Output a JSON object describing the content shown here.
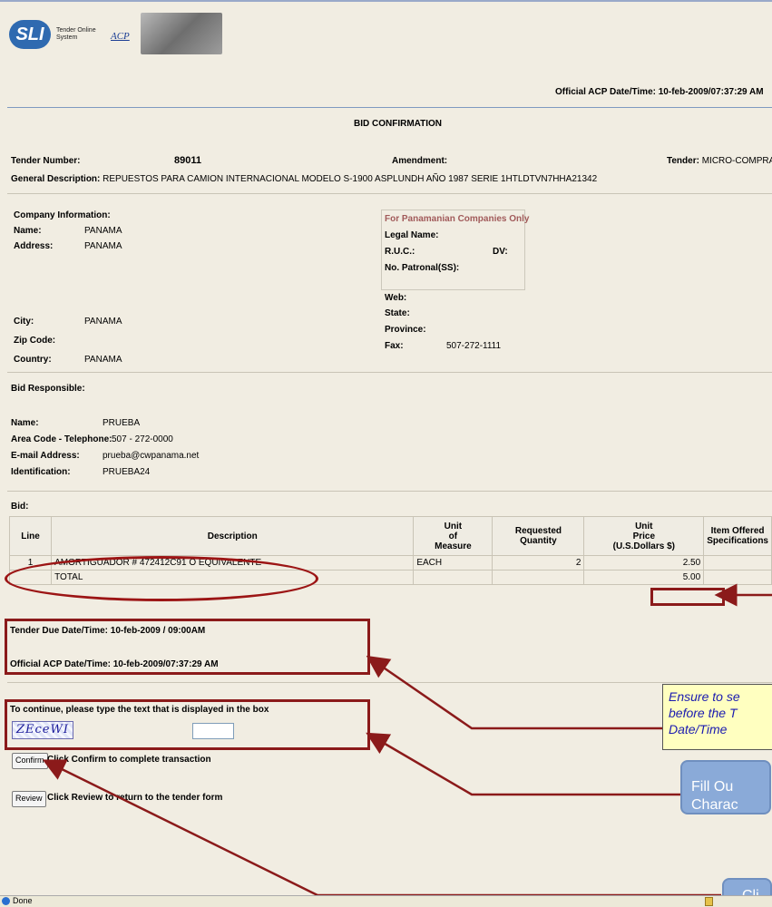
{
  "header": {
    "logo_text": "SLI",
    "logo_subtitle_1": "Tender Online",
    "logo_subtitle_2": "System",
    "acp_logo": "ACP",
    "official_datetime": "Official ACP Date/Time: 10-feb-2009/07:37:29 AM"
  },
  "title": "BID CONFIRMATION",
  "tender": {
    "number_label": "Tender Number:",
    "number": "89011",
    "amendment_label": "Amendment:",
    "tender_label": "Tender:",
    "tender_value": "MICRO-COMPRA",
    "description_label": "General Description:",
    "description": "REPUESTOS PARA CAMION INTERNACIONAL MODELO S-1900 ASPLUNDH AÑO 1987 SERIE 1HTLDTVN7HHA21342"
  },
  "company": {
    "section_label": "Company Information:",
    "name_label": "Name:",
    "name": "PANAMA",
    "address_label": "Address:",
    "address": "PANAMA",
    "city_label": "City:",
    "city": "PANAMA",
    "zip_label": "Zip Code:",
    "country_label": "Country:",
    "country": "PANAMA",
    "panama_only": "For Panamanian Companies Only",
    "legal_name_label": "Legal Name:",
    "ruc_label": "R.U.C.:",
    "dv_label": "DV:",
    "patronal_label": "No. Patronal(SS):",
    "web_label": "Web:",
    "state_label": "State:",
    "province_label": "Province:",
    "fax_label": "Fax:",
    "fax": "507-272-1111"
  },
  "responsible": {
    "section_label": "Bid Responsible:",
    "name_label": "Name:",
    "name": "PRUEBA",
    "phone_label": "Area Code - Telephone:",
    "phone": "507 - 272-0000",
    "email_label": "E-mail Address:",
    "email": "prueba@cwpanama.net",
    "id_label": "Identification:",
    "id": "PRUEBA24"
  },
  "bid": {
    "section_label": "Bid:",
    "columns": [
      "Line",
      "Description",
      "Unit of Measure",
      "Requested Quantity",
      "Unit Price (U.S.Dollars $)",
      "Item Offered Specifications"
    ],
    "col_uom_1": "Unit",
    "col_uom_2": "of",
    "col_uom_3": "Measure",
    "col_qty_1": "Requested",
    "col_qty_2": "Quantity",
    "col_price_1": "Unit",
    "col_price_2": "Price",
    "col_price_3": "(U.S.Dollars $)",
    "col_spec_1": "Item Offered",
    "col_spec_2": "Specifications",
    "rows": [
      {
        "line": "1",
        "description": "AMORTIGUADOR # 472412C91 O EQUIVALENTE",
        "uom": "EACH",
        "qty": "2",
        "price": "2.50",
        "spec": ""
      }
    ],
    "total_label": "TOTAL",
    "total": "5.00"
  },
  "dates": {
    "due": "Tender Due Date/Time: 10-feb-2009 / 09:00AM",
    "official": "Official ACP Date/Time: 10-feb-2009/07:37:29 AM"
  },
  "captcha": {
    "prompt": "To continue, please type the text that is displayed in the box",
    "code": "ZEceWI",
    "input_value": ""
  },
  "actions": {
    "confirm_label": "Confirm",
    "confirm_text": "Click Confirm to complete transaction",
    "review_label": "Review",
    "review_text": "Click Review to return to the tender form"
  },
  "annotations": {
    "callout_1": "Ensure to se",
    "callout_2": "before the T",
    "callout_3": "Date/Time",
    "fill_1": "Fill Ou",
    "fill_2": "Charac",
    "click_1": "Cli"
  },
  "statusbar": {
    "text": "Done"
  },
  "colors": {
    "background": "#f1ede2",
    "annotation_red": "#8b1a1a",
    "callout_text": "#1b1bb0",
    "callout_bg": "#ffffc0",
    "bluebox": "#8aaad8"
  }
}
